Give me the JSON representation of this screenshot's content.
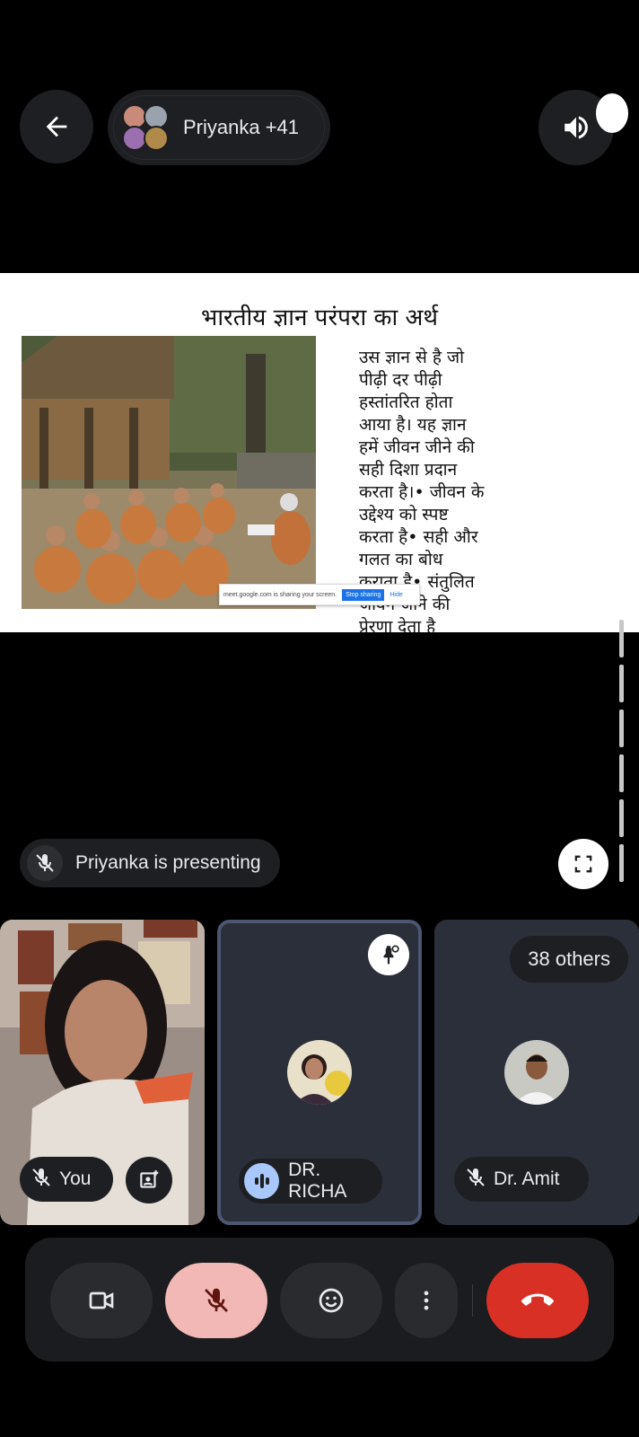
{
  "header": {
    "participants_label": "Priyanka +41"
  },
  "slide": {
    "title": "भारतीय ज्ञान परंपरा का अर्थ",
    "body_lines": [
      "उस ज्ञान से है जो",
      "पीढ़ी दर पीढ़ी",
      "हस्तांतरित होता",
      "आया है। यह ज्ञान",
      "हमें जीवन जीने की",
      "सही दिशा प्रदान",
      "करता है।• जीवन के",
      "उद्देश्य को स्पष्ट",
      "करता है• सही और",
      "गलत का बोध",
      "कराता है• संतुलित",
      "जीवन जीने की",
      "प्रेरणा देता है"
    ],
    "share_notice": {
      "text": "meet.google.com is sharing your screen.",
      "stop_label": "Stop sharing",
      "hide_label": "Hide"
    }
  },
  "presenting": {
    "label": "Priyanka is presenting"
  },
  "tiles": {
    "you": {
      "label": "You"
    },
    "richa": {
      "label": "DR. RICHA"
    },
    "amit": {
      "label": "Dr. Amit",
      "others_label": "38 others"
    }
  },
  "colors": {
    "background": "#000000",
    "surface": "#1e1f22",
    "mic_off_bg": "#f2b8b5",
    "end_call": "#d93025",
    "speaking_blue": "#a8c7fa"
  },
  "icons": {
    "back": "arrow-left-icon",
    "speaker": "volume-icon",
    "mic_off": "mic-off-icon",
    "fullscreen": "fullscreen-icon",
    "pin": "pin-icon",
    "camera": "videocam-icon",
    "emoji": "emoji-icon",
    "more": "more-vert-icon",
    "end": "call-end-icon"
  }
}
